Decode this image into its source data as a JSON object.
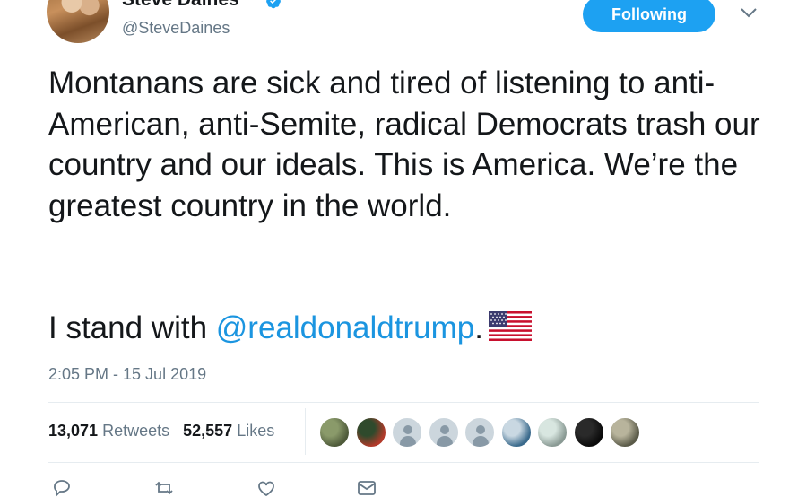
{
  "author": {
    "display_name": "Steve Daines",
    "handle": "@SteveDaines"
  },
  "follow_button": {
    "label": "Following"
  },
  "tweet": {
    "text": "Montanans are sick and tired of listening to anti-American, anti-Semite, radical Democrats trash our country and our ideals. This is America. We’re the greatest country in the world.",
    "line2_prefix": "I stand with ",
    "mention": "@realdonaldtrump",
    "line2_suffix": ".",
    "emoji": "us-flag-icon",
    "timestamp": "2:05 PM - 15 Jul 2019"
  },
  "stats": {
    "retweets_count": "13,071",
    "retweets_label": "Retweets",
    "likes_count": "52,557",
    "likes_label": "Likes"
  },
  "likers": [
    {
      "kind": "photo",
      "color_a": "#4e5a3a",
      "color_b": "#8a9a6a"
    },
    {
      "kind": "photo",
      "color_a": "#b23a2a",
      "color_b": "#2f4a2c"
    },
    {
      "kind": "default"
    },
    {
      "kind": "default"
    },
    {
      "kind": "default"
    },
    {
      "kind": "photo",
      "color_a": "#3a6a8c",
      "color_b": "#c9d8e2"
    },
    {
      "kind": "photo",
      "color_a": "#8a9a94",
      "color_b": "#d8e6e0"
    },
    {
      "kind": "photo",
      "color_a": "#0a0a0a",
      "color_b": "#2a2a2a"
    },
    {
      "kind": "photo",
      "color_a": "#5a5a48",
      "color_b": "#b8b49c"
    }
  ],
  "colors": {
    "accent": "#1da1f2",
    "link": "#1b95e0",
    "muted": "#657786",
    "text": "#14171a"
  }
}
